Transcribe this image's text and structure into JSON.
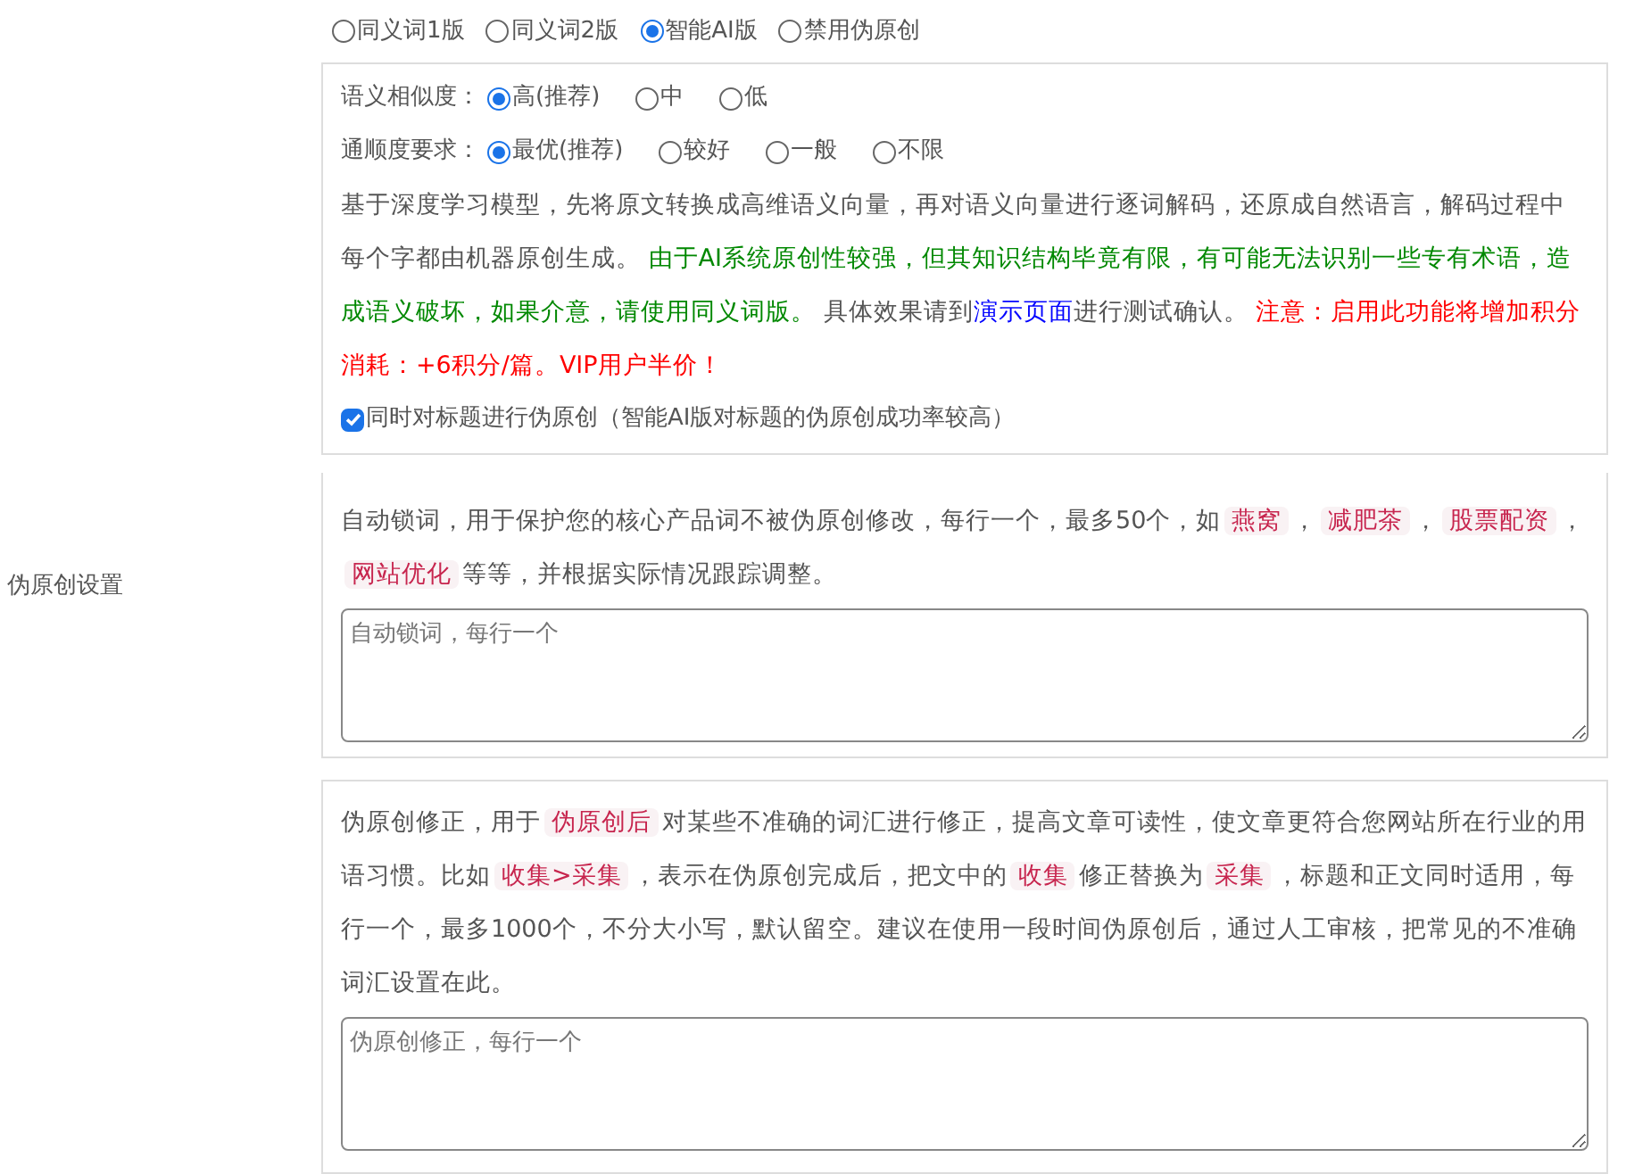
{
  "section_label": "伪原创设置",
  "modes": [
    {
      "label": "同义词1版",
      "selected": false
    },
    {
      "label": "同义词2版",
      "selected": false
    },
    {
      "label": "智能AI版",
      "selected": true
    },
    {
      "label": "禁用伪原创",
      "selected": false
    }
  ],
  "ai_panel": {
    "options": [
      {
        "label": "语义相似度：",
        "choices": [
          {
            "label": "高(推荐)",
            "selected": true
          },
          {
            "label": "中",
            "selected": false
          },
          {
            "label": "低",
            "selected": false
          }
        ]
      },
      {
        "label": "通顺度要求：",
        "choices": [
          {
            "label": "最优(推荐)",
            "selected": true
          },
          {
            "label": "较好",
            "selected": false
          },
          {
            "label": "一般",
            "selected": false
          },
          {
            "label": "不限",
            "selected": false
          }
        ]
      }
    ],
    "description": [
      {
        "kind": "plain",
        "text": "基于深度学习模型，先将原文转换成高维语义向量，再对语义向量进行逐词解码，还原成自然语言，解码过程中每个字都由机器原创生成。 "
      },
      {
        "kind": "green",
        "text": "由于AI系统原创性较强，但其知识结构毕竟有限，有可能无法识别一些专有术语，造成语义破坏，如果介意，请使用同义词版。"
      },
      {
        "kind": "plain",
        "text": " 具体效果请到"
      },
      {
        "kind": "link",
        "text": "演示页面"
      },
      {
        "kind": "plain",
        "text": "进行测试确认。 "
      },
      {
        "kind": "red",
        "text": "注意：启用此功能将增加积分消耗：+6积分/篇。VIP用户半价！"
      }
    ],
    "title_option": {
      "label": "同时对标题进行伪原创（智能AI版对标题的伪原创成功率较高）",
      "checked": true
    }
  },
  "lock_panel": {
    "description": [
      {
        "kind": "plain",
        "text": "自动锁词，用于保护您的核心产品词不被伪原创修改，每行一个，最多50个，如"
      },
      {
        "kind": "tag",
        "text": "燕窝"
      },
      {
        "kind": "plain",
        "text": "，"
      },
      {
        "kind": "tag",
        "text": "减肥茶"
      },
      {
        "kind": "plain",
        "text": "，"
      },
      {
        "kind": "tag",
        "text": "股票配资"
      },
      {
        "kind": "plain",
        "text": "，"
      },
      {
        "kind": "tag",
        "text": "网站优化"
      },
      {
        "kind": "plain",
        "text": "等等，并根据实际情况跟踪调整。"
      }
    ],
    "placeholder": "自动锁词，每行一个"
  },
  "fix_panel": {
    "description": [
      {
        "kind": "plain",
        "text": "伪原创修正，用于"
      },
      {
        "kind": "tag",
        "text": "伪原创后"
      },
      {
        "kind": "plain",
        "text": "对某些不准确的词汇进行修正，提高文章可读性，使文章更符合您网站所在行业的用语习惯。比如"
      },
      {
        "kind": "tag",
        "text": "收集>采集"
      },
      {
        "kind": "plain",
        "text": "，表示在伪原创完成后，把文中的"
      },
      {
        "kind": "tag",
        "text": "收集"
      },
      {
        "kind": "plain",
        "text": "修正替换为"
      },
      {
        "kind": "tag",
        "text": "采集"
      },
      {
        "kind": "plain",
        "text": "，标题和正文同时适用，每行一个，最多1000个，不分大小写，默认留空。建议在使用一段时间伪原创后，通过人工审核，把常见的不准确词汇设置在此。"
      }
    ],
    "placeholder": "伪原创修正，每行一个"
  }
}
